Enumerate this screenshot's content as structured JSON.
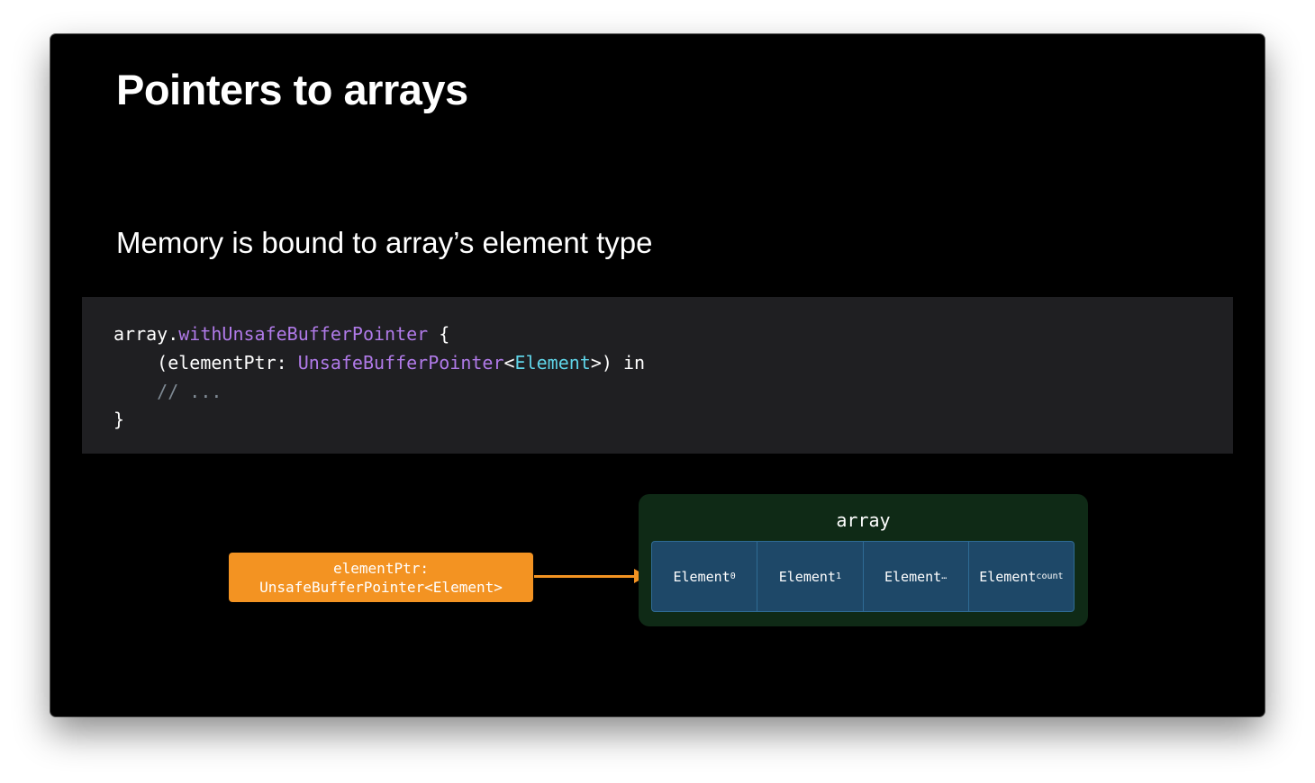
{
  "slide": {
    "title": "Pointers to arrays",
    "subtitle": "Memory is bound to array’s element type"
  },
  "code": {
    "line1_a": "array.",
    "line1_b": "withUnsafeBufferPointer",
    "line1_c": " {",
    "line2_a": "    (elementPtr: ",
    "line2_b": "UnsafeBufferPointer",
    "line2_c": "<",
    "line2_d": "Element",
    "line2_e": ">) in",
    "line3": "    // ...",
    "line4": "}"
  },
  "diagram": {
    "pointer_line1": "elementPtr:",
    "pointer_line2": "UnsafeBufferPointer<Element>",
    "array_label": "array",
    "cells": [
      {
        "name": "Element",
        "sub": "0"
      },
      {
        "name": "Element",
        "sub": "1"
      },
      {
        "name": "Element",
        "sub": "…"
      },
      {
        "name": "Element",
        "sub": "count"
      }
    ]
  },
  "colors": {
    "pointer_box": "#f39322",
    "array_container": "#0f2a16",
    "cell_fill": "#1e4868",
    "keyword_purple": "#b07ae8",
    "type_cyan": "#5fd4e8"
  }
}
